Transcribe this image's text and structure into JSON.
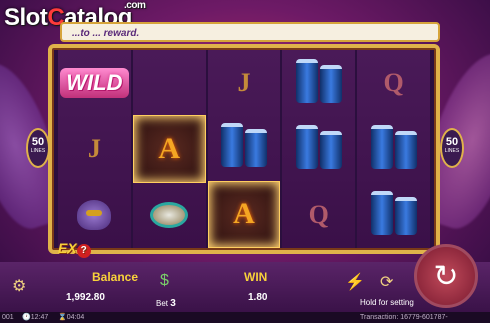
{
  "logo": {
    "pre": "Slot",
    "accent": "C",
    "rest": "atalog",
    "domain": ".com"
  },
  "banner": {
    "text": "...to ... reward."
  },
  "lines": {
    "count": "50",
    "label": "LINES"
  },
  "reels": [
    [
      {
        "type": "wild",
        "label": "WILD"
      },
      {
        "type": "letter",
        "v": "J"
      },
      {
        "type": "mask"
      }
    ],
    [
      {
        "type": "blank"
      },
      {
        "type": "letter",
        "v": "A",
        "hl": true
      },
      {
        "type": "tamb"
      }
    ],
    [
      {
        "type": "letter",
        "v": "J"
      },
      {
        "type": "drums"
      },
      {
        "type": "letter",
        "v": "A",
        "hl": true
      }
    ],
    [
      {
        "type": "drums"
      },
      {
        "type": "drums"
      },
      {
        "type": "letter",
        "v": "Q"
      }
    ],
    [
      {
        "type": "letter",
        "v": "Q"
      },
      {
        "type": "drums"
      },
      {
        "type": "drums"
      }
    ]
  ],
  "feature": {
    "ex": "EX",
    "help": "?"
  },
  "footer": {
    "balance_label": "Balance",
    "balance_value": "1,992.80",
    "bet_label": "Bet",
    "bet_value": "3",
    "win_label": "WIN",
    "win_value": "1.80",
    "hold_label": "Hold for setting"
  },
  "status": {
    "left_id": "001",
    "time1": "12:47",
    "time2": "04:04",
    "transaction": "Transaction: 16779-601787-"
  },
  "colors": {
    "accent": "#f8d23a",
    "frame": "#e0b24a"
  }
}
